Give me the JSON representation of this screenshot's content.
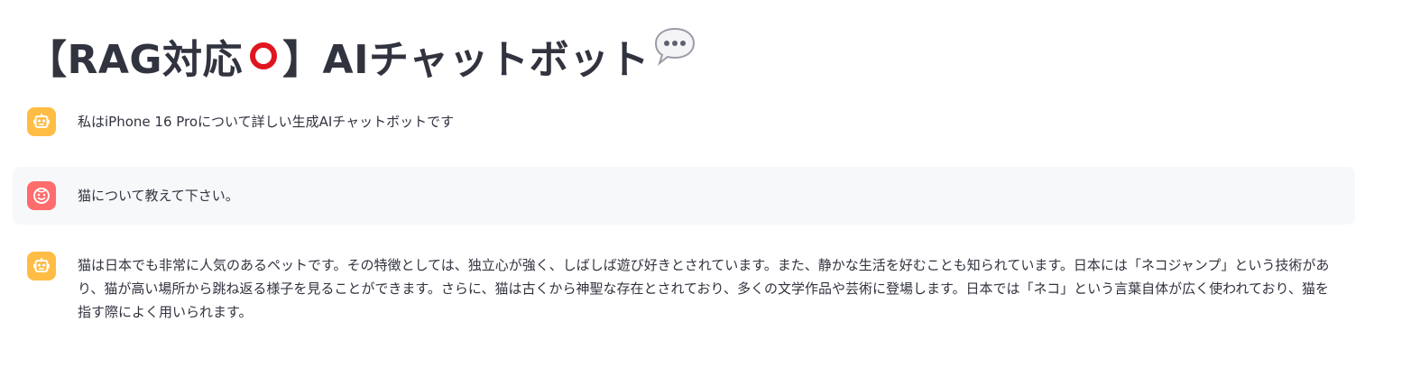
{
  "page": {
    "title_prefix": "【RAG対応",
    "title_suffix": "】AIチャットボット",
    "title_icons": [
      "heavy-large-circle-icon",
      "speech-bubble-icon"
    ]
  },
  "messages": [
    {
      "role": "assistant",
      "avatar_icon": "robot-face-icon",
      "text": "私はiPhone 16 Proについて詳しい生成AIチャットボットです"
    },
    {
      "role": "user",
      "avatar_icon": "smiling-face-icon",
      "text": "猫について教えて下さい。"
    },
    {
      "role": "assistant",
      "avatar_icon": "robot-face-icon",
      "text": "猫は日本でも非常に人気のあるペットです。その特徴としては、独立心が強く、しばしば遊び好きとされています。また、静かな生活を好むことも知られています。日本には「ネコジャンプ」という技術があり、猫が高い場所から跳ね返る様子を見ることができます。さらに、猫は古くから神聖な存在とされており、多くの文学作品や芸術に登場します。日本では「ネコ」という言葉自体が広く使われており、猫を指す際によく用いられます。"
    }
  ],
  "colors": {
    "text": "#31333f",
    "assistant_avatar": "#ffbd45",
    "user_avatar": "#ff6c6c",
    "user_message_bg": "#f7f8fa",
    "title_ring": "#e0161f"
  }
}
